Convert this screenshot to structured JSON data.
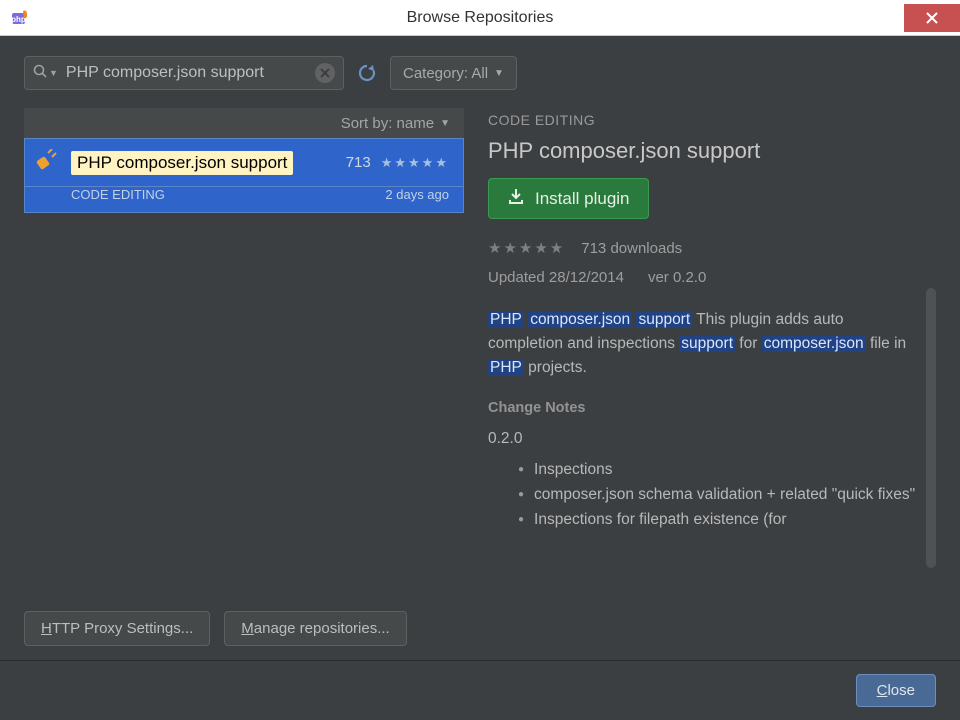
{
  "window": {
    "title": "Browse Repositories"
  },
  "toolbar": {
    "search_value": "PHP composer.json support",
    "category_label": "Category: All",
    "refresh_tooltip": "Refresh"
  },
  "list": {
    "sort_label": "Sort by: name",
    "items": [
      {
        "name": "PHP composer.json support",
        "downloads": "713",
        "category": "CODE EDITING",
        "age": "2 days ago"
      }
    ]
  },
  "detail": {
    "category": "CODE EDITING",
    "title": "PHP composer.json support",
    "install_label": "Install plugin",
    "downloads_label": "713 downloads",
    "updated_label": "Updated 28/12/2014",
    "version_label": "ver 0.2.0",
    "desc_tokens": [
      {
        "t": "PHP",
        "hl": true
      },
      {
        "t": " "
      },
      {
        "t": "composer.json",
        "hl": true
      },
      {
        "t": " "
      },
      {
        "t": "support",
        "hl": true
      },
      {
        "t": " This plugin adds auto completion and inspections "
      },
      {
        "t": "support",
        "hl": true
      },
      {
        "t": " for "
      },
      {
        "t": "composer.json",
        "hl": true
      },
      {
        "t": " file in "
      },
      {
        "t": "PHP",
        "hl": true
      },
      {
        "t": " projects."
      }
    ],
    "change_notes_heading": "Change Notes",
    "change_version": "0.2.0",
    "notes": [
      [
        {
          "t": "Inspections"
        }
      ],
      [
        {
          "t": "composer.json",
          "hl": true
        },
        {
          "t": " schema validation + related \"quick fixes\""
        }
      ],
      [
        {
          "t": "Inspections for filepath existence (for"
        }
      ]
    ]
  },
  "buttons": {
    "http_proxy": "HTTP Proxy Settings...",
    "manage_repos": "Manage repositories...",
    "close": "Close"
  }
}
